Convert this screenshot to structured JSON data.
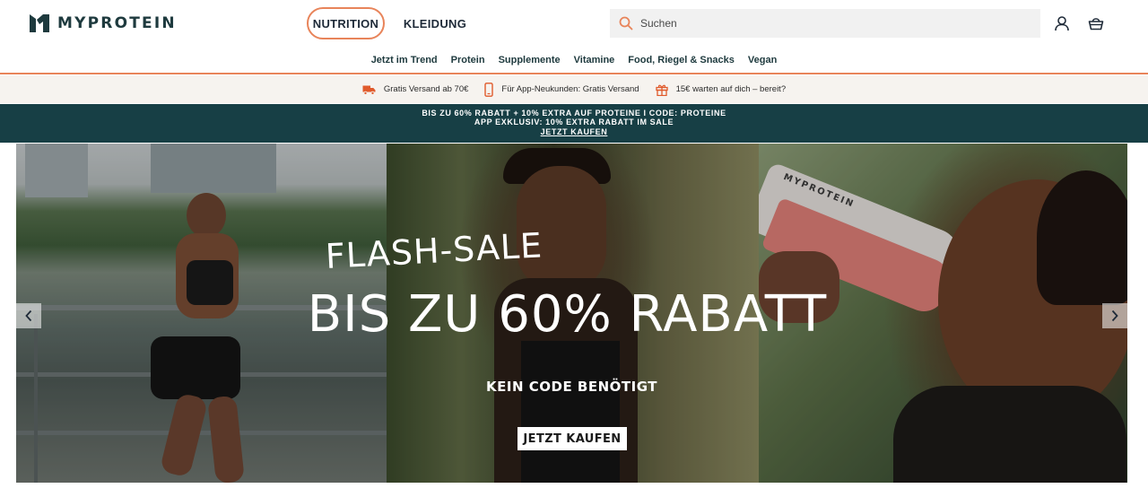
{
  "header": {
    "logo_text": "MYPROTEIN",
    "tabs": [
      {
        "label": "NUTRITION",
        "active": true
      },
      {
        "label": "KLEIDUNG",
        "active": false
      }
    ],
    "search": {
      "placeholder": "Suchen"
    },
    "icons": [
      "search-icon",
      "account-icon",
      "basket-icon"
    ]
  },
  "category_nav": {
    "items": [
      "Jetzt im Trend",
      "Protein",
      "Supplemente",
      "Vitamine",
      "Food, Riegel & Snacks",
      "Vegan"
    ]
  },
  "benefits": [
    {
      "icon": "truck-icon",
      "text": "Gratis Versand ab 70€"
    },
    {
      "icon": "phone-icon",
      "text": "Für App-Neukunden: Gratis Versand"
    },
    {
      "icon": "gift-icon",
      "text": "15€ warten auf dich – bereit?"
    }
  ],
  "promo": {
    "line1": "BIS ZU 60% RABATT + 10% EXTRA AUF PROTEINE I CODE: PROTEINE",
    "line2": "APP EXKLUSIV: 10% EXTRA RABATT IM SALE",
    "link": "JETZT KAUFEN"
  },
  "hero": {
    "kicker": "FLASH-SALE",
    "title": "BIS ZU 60% RABATT",
    "subtitle": "KEIN CODE BENÖTIGT",
    "cta": "JETZT KAUFEN",
    "bottle_text": "MYPROTEIN"
  },
  "colors": {
    "accent": "#e8845a",
    "promo_bg": "#173f45",
    "benefits_bg": "#f6f3ef",
    "brand_text": "#1e3a3e"
  }
}
